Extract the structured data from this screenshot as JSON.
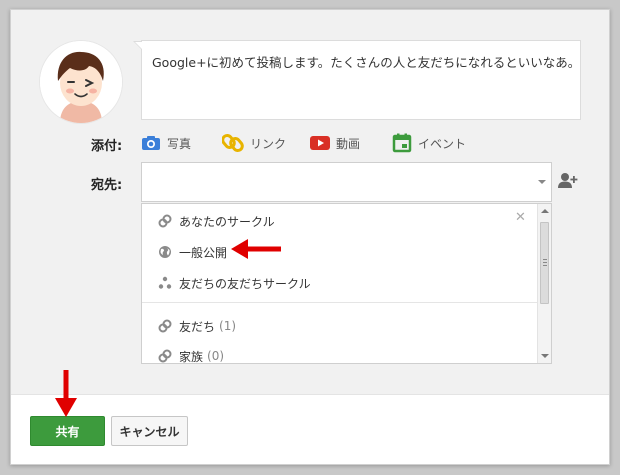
{
  "post": {
    "text": "Google+に初めて投稿します。たくさんの人と友だちになれるといいなあ。"
  },
  "attach": {
    "label": "添付:",
    "photo": "写真",
    "link": "リンク",
    "video": "動画",
    "event": "イベント"
  },
  "recipient": {
    "label": "宛先:",
    "value": ""
  },
  "dropdown": {
    "items": [
      {
        "label": "あなたのサークル",
        "icon": "circle-link-icon"
      },
      {
        "label": "一般公開",
        "icon": "globe-icon"
      },
      {
        "label": "友だちの友だちサークル",
        "icon": "extended-circles-icon"
      },
      {
        "label": "友だち",
        "count": "(1)",
        "icon": "circle-link-icon"
      },
      {
        "label": "家族",
        "count": "(0)",
        "icon": "circle-link-icon"
      }
    ]
  },
  "buttons": {
    "share": "共有",
    "cancel": "キャンセル"
  },
  "colors": {
    "share_button": "#3d9b3d",
    "annotation_arrow": "#e00000",
    "photo_icon": "#3b7fd9",
    "link_icon": "#e8b400",
    "video_icon": "#d93025",
    "event_icon": "#3d9b3d"
  }
}
